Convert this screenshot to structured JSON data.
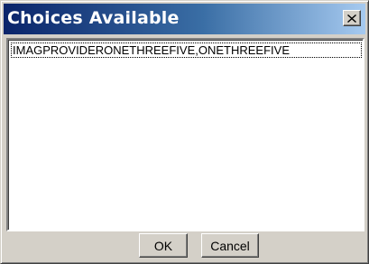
{
  "dialog": {
    "title": "Choices Available",
    "close_icon": "close-x-icon"
  },
  "list": {
    "items": [
      {
        "label": "IMAGPROVIDERONETHREEFIVE,ONETHREEFIVE"
      }
    ]
  },
  "buttons": {
    "ok_label": "OK",
    "cancel_label": "Cancel"
  },
  "colors": {
    "title_gradient_start": "#0a246a",
    "title_gradient_end": "#a6caf0",
    "face": "#d4d0c8"
  }
}
